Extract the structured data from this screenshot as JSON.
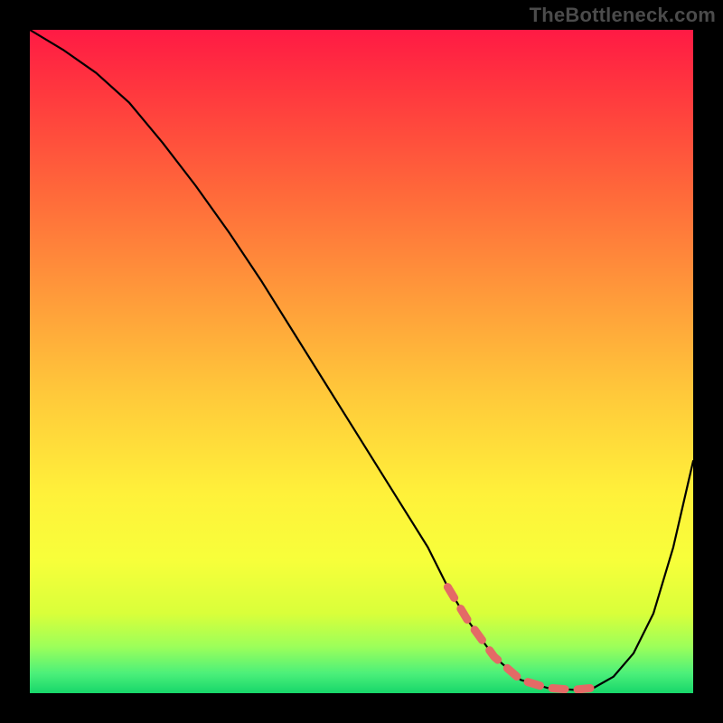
{
  "watermark": "TheBottleneck.com",
  "chart_data": {
    "type": "line",
    "title": "",
    "xlabel": "",
    "ylabel": "",
    "xlim": [
      0,
      100
    ],
    "ylim": [
      0,
      100
    ],
    "grid": false,
    "legend": false,
    "background": "vertical-gradient red→green",
    "series": [
      {
        "name": "bottleneck-curve",
        "color": "#000000",
        "x": [
          0,
          5,
          10,
          15,
          20,
          25,
          30,
          35,
          40,
          45,
          50,
          55,
          60,
          63,
          66,
          70,
          74,
          78,
          82,
          85,
          88,
          91,
          94,
          97,
          100
        ],
        "y": [
          100,
          97,
          93.5,
          89,
          83,
          76.5,
          69.5,
          62,
          54,
          46,
          38,
          30,
          22,
          16,
          11,
          5.5,
          2,
          0.8,
          0.5,
          0.8,
          2.5,
          6,
          12,
          22,
          35
        ]
      }
    ],
    "annotations": [
      {
        "name": "optimal-range-highlight",
        "style": "dashed",
        "color": "#e46a66",
        "x": [
          63,
          66,
          70,
          74,
          78,
          82,
          85
        ],
        "y": [
          16,
          11,
          5.5,
          2,
          0.8,
          0.5,
          0.8
        ]
      }
    ]
  }
}
